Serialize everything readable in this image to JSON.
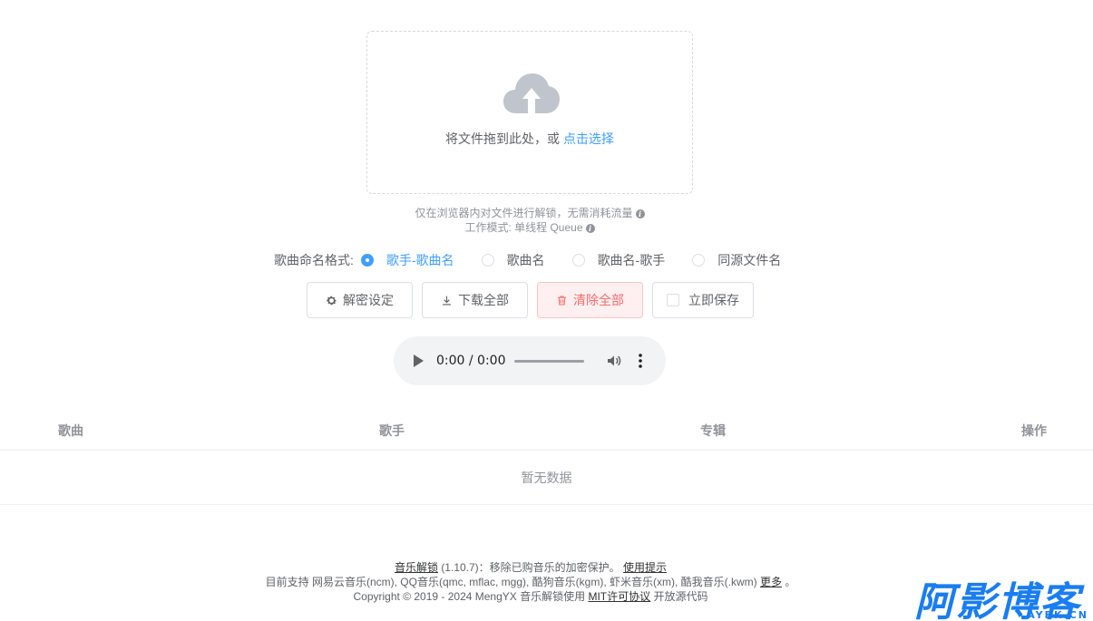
{
  "upload": {
    "hint_text": "将文件拖到此处，或",
    "select_link": "点击选择"
  },
  "tips": {
    "line1": "仅在浏览器内对文件进行解锁，无需消耗流量",
    "line2": "工作模式: 单线程 Queue"
  },
  "naming": {
    "label": "歌曲命名格式:",
    "options": [
      "歌手-歌曲名",
      "歌曲名",
      "歌曲名-歌手",
      "同源文件名"
    ],
    "selected": "歌手-歌曲名"
  },
  "toolbar": {
    "decrypt_settings": "解密设定",
    "download_all": "下载全部",
    "clear_all": "清除全部",
    "save_now": "立即保存"
  },
  "player": {
    "time": "0:00 / 0:00"
  },
  "table": {
    "columns": [
      "歌曲",
      "歌手",
      "专辑",
      "操作"
    ],
    "empty_text": "暂无数据"
  },
  "footer": {
    "app_name": "音乐解锁",
    "version_desc": "(1.10.7)：移除已购音乐的加密保护。",
    "usage_tip": "使用提示",
    "support_text": "目前支持 网易云音乐(ncm), QQ音乐(qmc, mflac, mgg), 酷狗音乐(kgm), 虾米音乐(xm), 酷我音乐(.kwm)",
    "more": "更多",
    "period": "。",
    "copyright": "Copyright © 2019 - 2024 MengYX 音乐解锁使用",
    "license": "MIT许可协议",
    "open_source": "开放源代码"
  },
  "watermark": {
    "big": "阿影博客",
    "small": "AYBK.CN"
  },
  "colors": {
    "accent": "#409eff",
    "danger": "#f56c6c",
    "watermark": "#1a7df0"
  }
}
